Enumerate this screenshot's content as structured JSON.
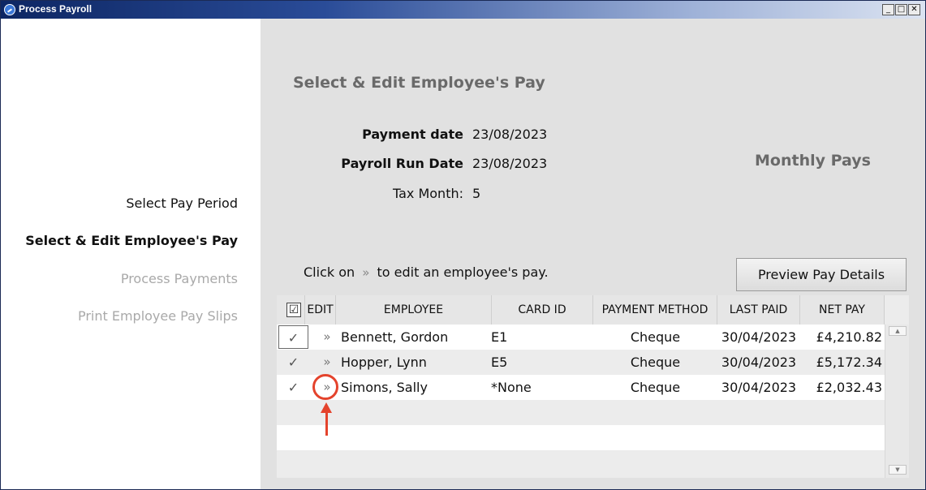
{
  "window": {
    "title": "Process Payroll",
    "minimize_label": "_",
    "maximize_label": "□",
    "close_label": "✕"
  },
  "sidebar": {
    "items": [
      {
        "label": "Select Pay Period"
      },
      {
        "label": "Select & Edit Employee's Pay"
      },
      {
        "label": "Process Payments"
      },
      {
        "label": "Print Employee Pay Slips"
      }
    ]
  },
  "main": {
    "heading": "Select & Edit Employee's Pay",
    "payment_date_label": "Payment date",
    "payment_date_value": "23/08/2023",
    "payroll_run_label": "Payroll Run Date",
    "payroll_run_value": "23/08/2023",
    "tax_month_label": "Tax Month:",
    "tax_month_value": "5",
    "pay_type": "Monthly Pays",
    "hint_before": "Click on",
    "hint_after": "to edit an employee's pay.",
    "preview_button": "Preview Pay Details"
  },
  "icons": {
    "check": "✓",
    "edit_chevron": "»",
    "header_checkbox": "☑"
  },
  "table": {
    "headers": {
      "edit": "EDIT",
      "employee": "EMPLOYEE",
      "card_id": "CARD ID",
      "payment_method": "PAYMENT METHOD",
      "last_paid": "LAST PAID",
      "net_pay": "NET PAY"
    },
    "rows": [
      {
        "employee": "Bennett, Gordon",
        "card_id": "E1",
        "payment_method": "Cheque",
        "last_paid": "30/04/2023",
        "net_pay": "£4,210.82"
      },
      {
        "employee": "Hopper, Lynn",
        "card_id": "E5",
        "payment_method": "Cheque",
        "last_paid": "30/04/2023",
        "net_pay": "£5,172.34"
      },
      {
        "employee": "Simons, Sally",
        "card_id": "*None",
        "payment_method": "Cheque",
        "last_paid": "30/04/2023",
        "net_pay": "£2,032.43"
      }
    ]
  },
  "colors": {
    "annotation": "#e4432c",
    "panel_bg": "#e1e1e1",
    "title_bar": "#0d2663"
  }
}
